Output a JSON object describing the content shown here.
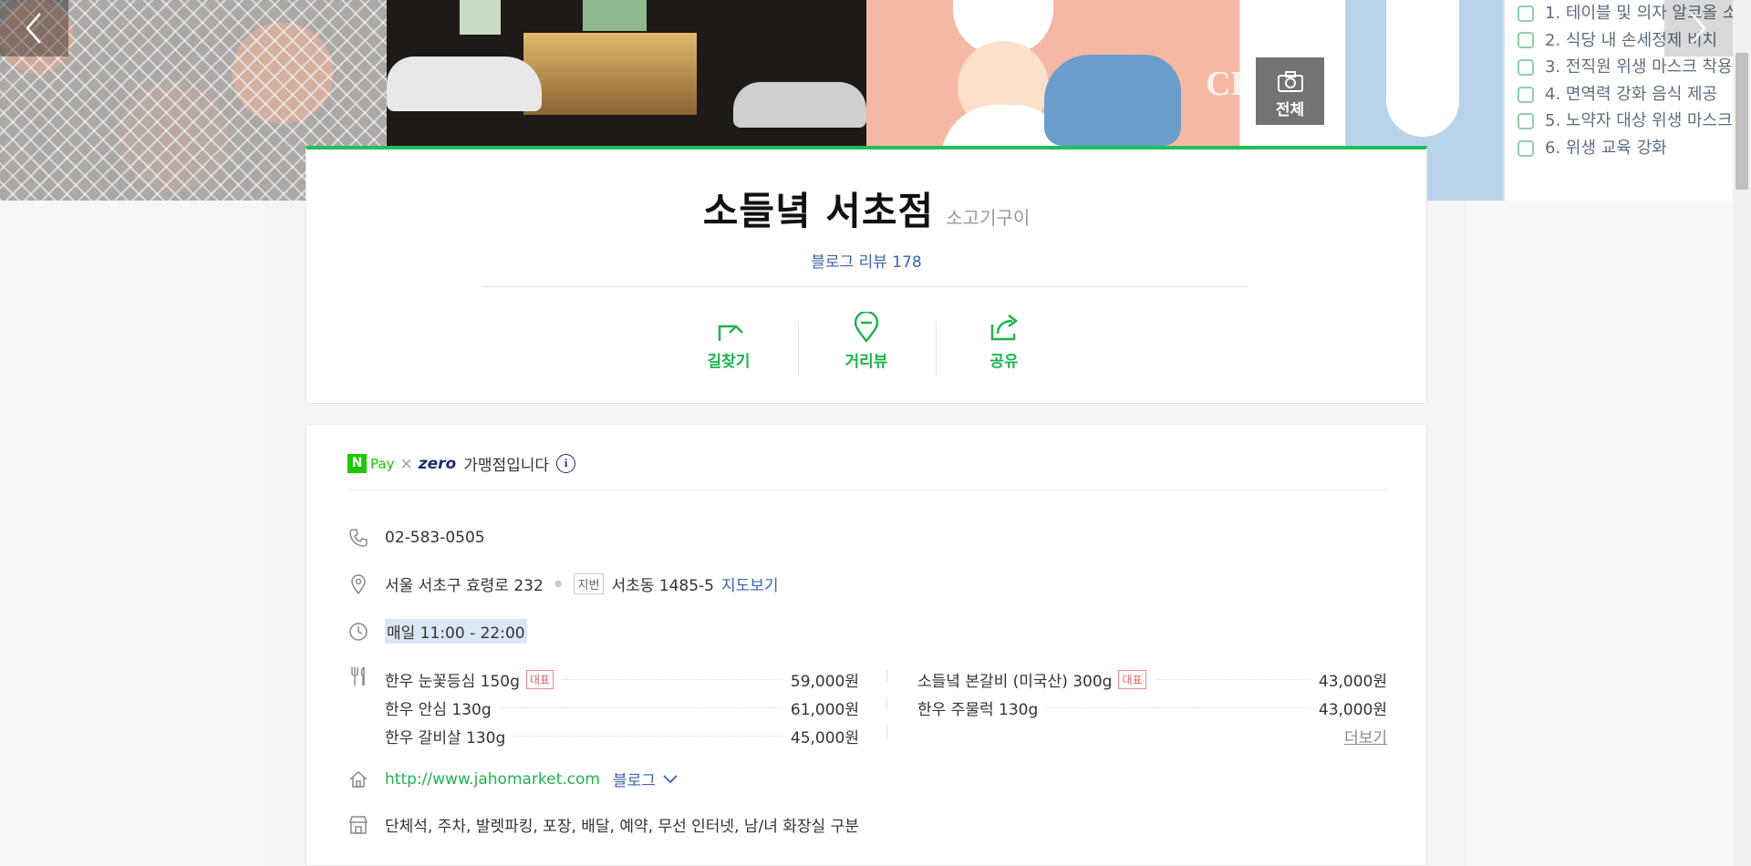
{
  "gallery": {
    "all_label": "전체",
    "notice_items": [
      "1. 테이블 및 의자 알코올 소",
      "2. 식당 내 손세정제 비치",
      "3. 전직원 위생 마스크 착용",
      "4. 면역력 강화 음식 제공",
      "5. 노약자 대상 위생 마스크",
      "6. 위생 교육 강화"
    ],
    "photo_text": "CHE"
  },
  "place": {
    "name": "소들녘 서초점",
    "category": "소고기구이",
    "review_label": "블로그 리뷰 178"
  },
  "actions": [
    {
      "label": "길찾기",
      "icon": "directions-icon"
    },
    {
      "label": "거리뷰",
      "icon": "streetview-icon"
    },
    {
      "label": "공유",
      "icon": "share-icon"
    }
  ],
  "pay": {
    "n_logo": "N",
    "pay_label": "Pay",
    "times": "×",
    "zero": "zero",
    "text": "가맹점입니다",
    "info": "i"
  },
  "details": {
    "phone": "02-583-0505",
    "address": "서울 서초구 효령로 232",
    "jibun_tag": "지번",
    "jibun": "서초동 1485-5",
    "map_link": "지도보기",
    "hours": "매일 11:00 - 22:00",
    "website": "http://www.jahomarket.com",
    "blog_label": "블로그",
    "amenities": "단체석, 주차, 발렛파킹, 포장, 배달, 예약, 무선 인터넷, 남/녀 화장실 구분"
  },
  "menu": {
    "rep_label": "대표",
    "more_label": "더보기",
    "left": [
      {
        "name": "한우 눈꽃등심 150g",
        "price": "59,000원",
        "rep": true
      },
      {
        "name": "한우 안심 130g",
        "price": "61,000원",
        "rep": false
      },
      {
        "name": "한우 갈비살 130g",
        "price": "45,000원",
        "rep": false
      }
    ],
    "right": [
      {
        "name": "소들녘 본갈비 (미국산) 300g",
        "price": "43,000원",
        "rep": true
      },
      {
        "name": "한우 주물럭 130g",
        "price": "43,000원",
        "rep": false
      }
    ]
  },
  "colors": {
    "accent_green": "#1fb34f",
    "link_blue": "#3c64a8",
    "npay_green": "#1ec800",
    "rep_red": "#e06464"
  }
}
